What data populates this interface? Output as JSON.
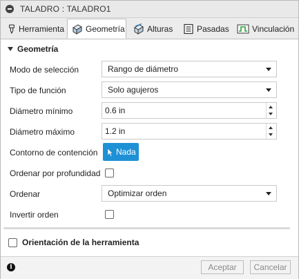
{
  "window": {
    "title": "TALADRO : TALADRO1"
  },
  "tabs": [
    {
      "label": "Herramienta",
      "icon": "tool-icon"
    },
    {
      "label": "Geometría",
      "icon": "geometry-cube-icon",
      "active": true
    },
    {
      "label": "Alturas",
      "icon": "heights-icon"
    },
    {
      "label": "Pasadas",
      "icon": "passes-icon"
    },
    {
      "label": "Vinculación",
      "icon": "linking-icon"
    }
  ],
  "section": {
    "title": "Geometría"
  },
  "fields": {
    "selection_mode": {
      "label": "Modo de selección",
      "value": "Rango de diámetro"
    },
    "feature_type": {
      "label": "Tipo de función",
      "value": "Solo agujeros"
    },
    "min_diameter": {
      "label": "Diámetro mínimo",
      "value": "0.6 in"
    },
    "max_diameter": {
      "label": "Diámetro máximo",
      "value": "1.2 in"
    },
    "containment": {
      "label": "Contorno de contención",
      "button_label": "Nada"
    },
    "order_by_depth": {
      "label": "Ordenar por profundidad",
      "checked": false
    },
    "order": {
      "label": "Ordenar",
      "value": "Optimizar orden"
    },
    "reverse_order": {
      "label": "Invertir orden",
      "checked": false
    }
  },
  "collapsed_section": {
    "title": "Orientación de la herramienta",
    "checked": false
  },
  "footer": {
    "ok_label": "Aceptar",
    "cancel_label": "Cancelar",
    "info_icon": "i"
  },
  "colors": {
    "accent": "#1e91d6",
    "header_bg": "#e9e9e9",
    "tabs_bg": "#ececec"
  }
}
